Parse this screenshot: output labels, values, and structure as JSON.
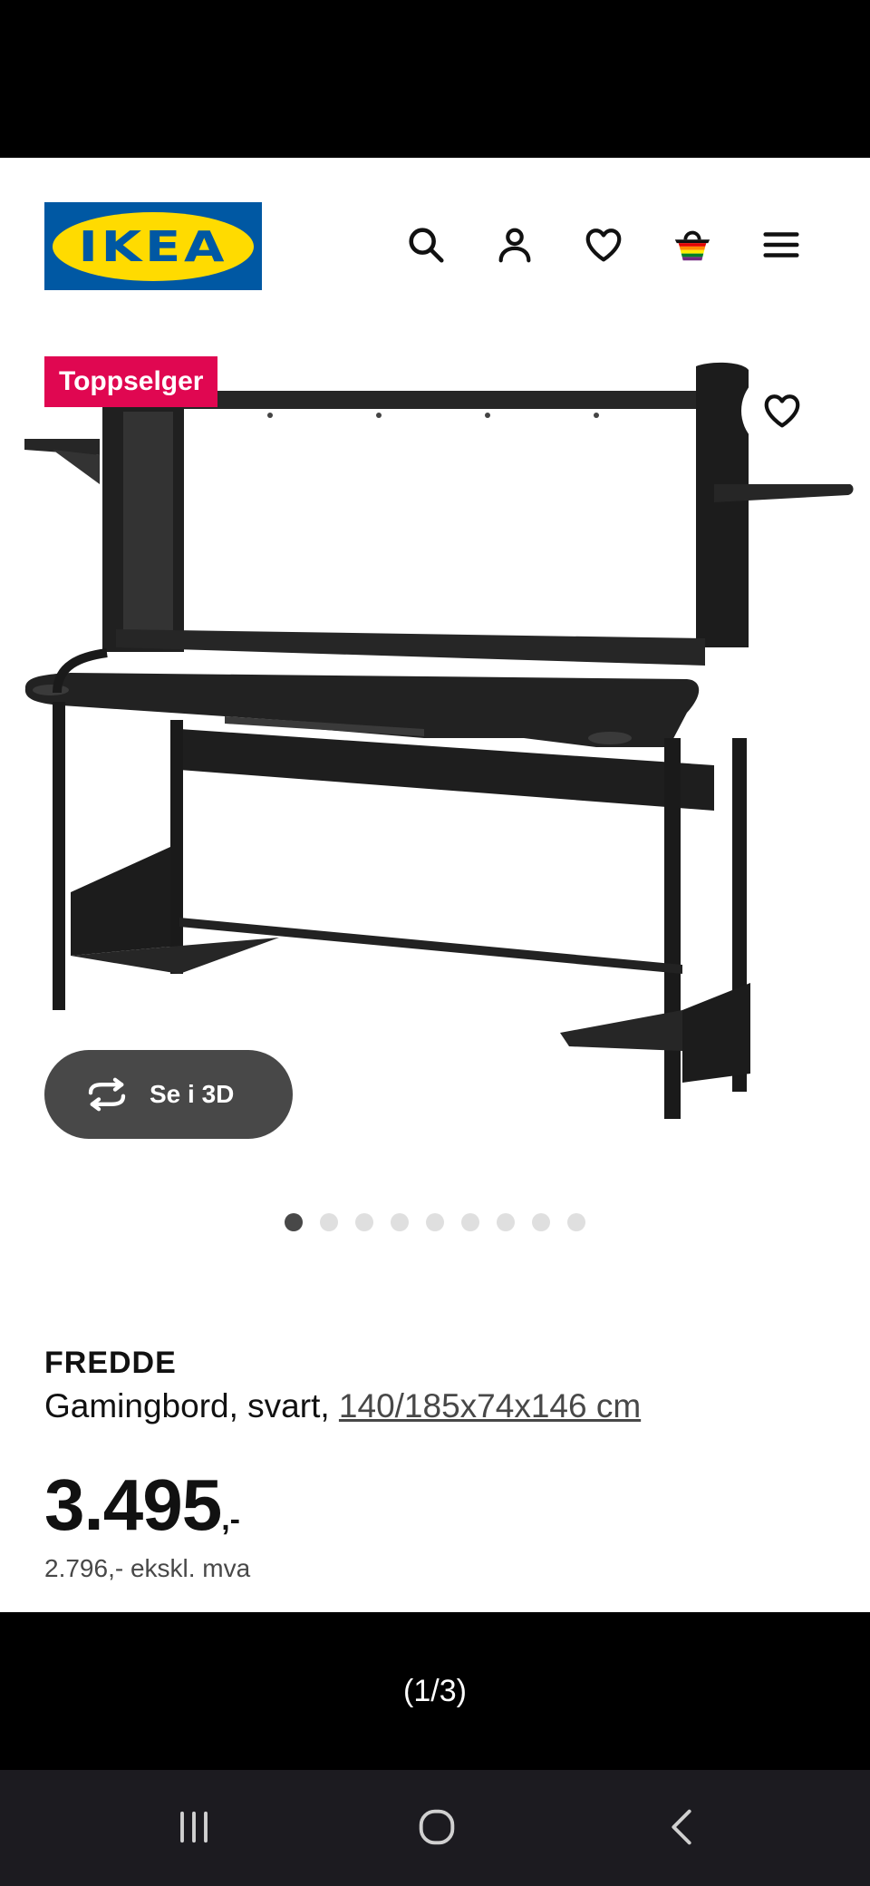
{
  "header": {
    "logo_text": "IKEA",
    "icons": [
      "search-icon",
      "user-icon",
      "heart-icon",
      "basket-icon",
      "menu-icon"
    ]
  },
  "product": {
    "badge": "Toppselger",
    "view_3d_label": "Se i 3D",
    "image_count": 9,
    "active_image": 1,
    "name": "FREDDE",
    "description": "Gamingbord, svart,",
    "dimensions": "140/185x74x146 cm",
    "price_main": "3.495",
    "price_suffix": ",-",
    "price_ex_vat": "2.796,- ekskl. mva"
  },
  "caption": "(1/3)",
  "colors": {
    "ikea_blue": "#0058a3",
    "ikea_yellow": "#ffdb00",
    "badge": "#e00751",
    "button_dark": "#484848"
  },
  "navigation": {
    "buttons": [
      "recent-apps-icon",
      "home-icon",
      "back-icon"
    ]
  }
}
